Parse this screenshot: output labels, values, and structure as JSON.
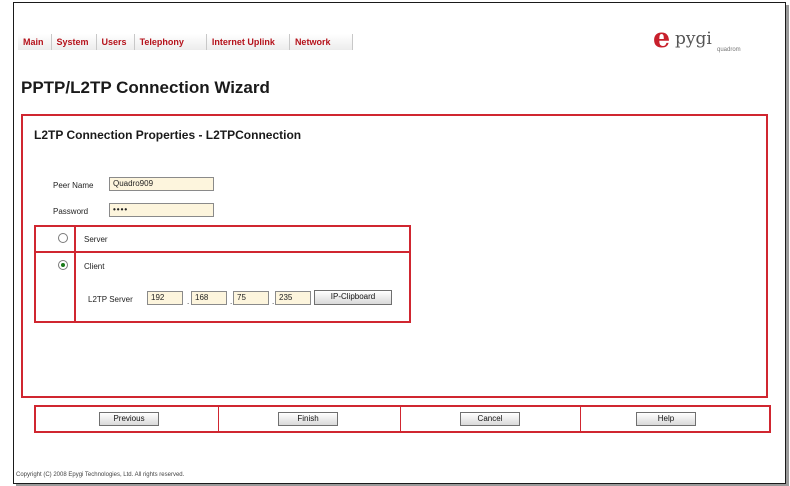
{
  "nav": {
    "items": [
      "Main",
      "System",
      "Users",
      "Telephony",
      "Internet Uplink",
      "Network"
    ]
  },
  "logo": {
    "glyph": "e",
    "word": "pygi",
    "sub": "quadrom",
    "color": "#c8202c"
  },
  "page": {
    "title": "PPTP/L2TP Connection Wizard"
  },
  "section": {
    "title": "L2TP Connection Properties - L2TPConnection"
  },
  "form": {
    "peer_name_label": "Peer Name",
    "peer_name_value": "Quadro909",
    "password_label": "Password",
    "password_value": "••••"
  },
  "mode": {
    "server_label": "Server",
    "client_label": "Client",
    "selected": "Client",
    "l2tp_server_label": "L2TP Server",
    "ip": [
      "192",
      "168",
      "75",
      "235"
    ],
    "ip_sep": ".",
    "clipboard_label": "IP-Clipboard"
  },
  "buttons": {
    "previous": "Previous",
    "finish": "Finish",
    "cancel": "Cancel",
    "help": "Help"
  },
  "footer": {
    "copyright": "Copyright (C) 2008 Epygi Technologies, Ltd. All rights reserved."
  },
  "colors": {
    "accent": "#d02630",
    "input_bg": "#fdf5dd"
  }
}
